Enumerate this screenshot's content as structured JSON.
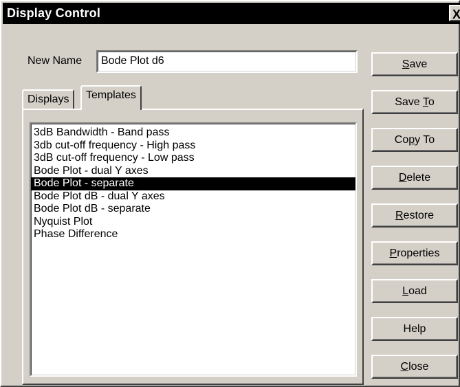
{
  "window": {
    "title": "Display Control",
    "close_glyph": "X"
  },
  "name_field": {
    "label": "New Name",
    "value": "Bode Plot d6"
  },
  "tabs": [
    {
      "label": "Displays",
      "active": false
    },
    {
      "label": "Templates",
      "active": true
    }
  ],
  "templates_list": {
    "selected_index": 4,
    "items": [
      "3dB Bandwidth - Band pass",
      "3db cut-off frequency - High pass",
      "3dB cut-off frequency - Low pass",
      "Bode Plot - dual Y axes",
      "Bode Plot - separate",
      "Bode Plot dB - dual Y axes",
      "Bode Plot dB - separate",
      "Nyquist Plot",
      "Phase Difference"
    ]
  },
  "buttons": [
    {
      "name": "save-button",
      "label": "Save",
      "mnemonic": "S"
    },
    {
      "name": "save-to-button",
      "label": "Save To",
      "mnemonic": "T"
    },
    {
      "name": "copy-to-button",
      "label": "Copy To",
      "mnemonic": "p"
    },
    {
      "name": "delete-button",
      "label": "Delete",
      "mnemonic": "D"
    },
    {
      "name": "restore-button",
      "label": "Restore",
      "mnemonic": "R"
    },
    {
      "name": "properties-button",
      "label": "Properties",
      "mnemonic": "P"
    },
    {
      "name": "load-button",
      "label": "Load",
      "mnemonic": "L"
    },
    {
      "name": "help-button",
      "label": "Help",
      "mnemonic": ""
    },
    {
      "name": "close-button",
      "label": "Close",
      "mnemonic": "C"
    }
  ],
  "colors": {
    "face": "#d4d0c8",
    "titlebar": "#000000",
    "selection": "#000000"
  }
}
